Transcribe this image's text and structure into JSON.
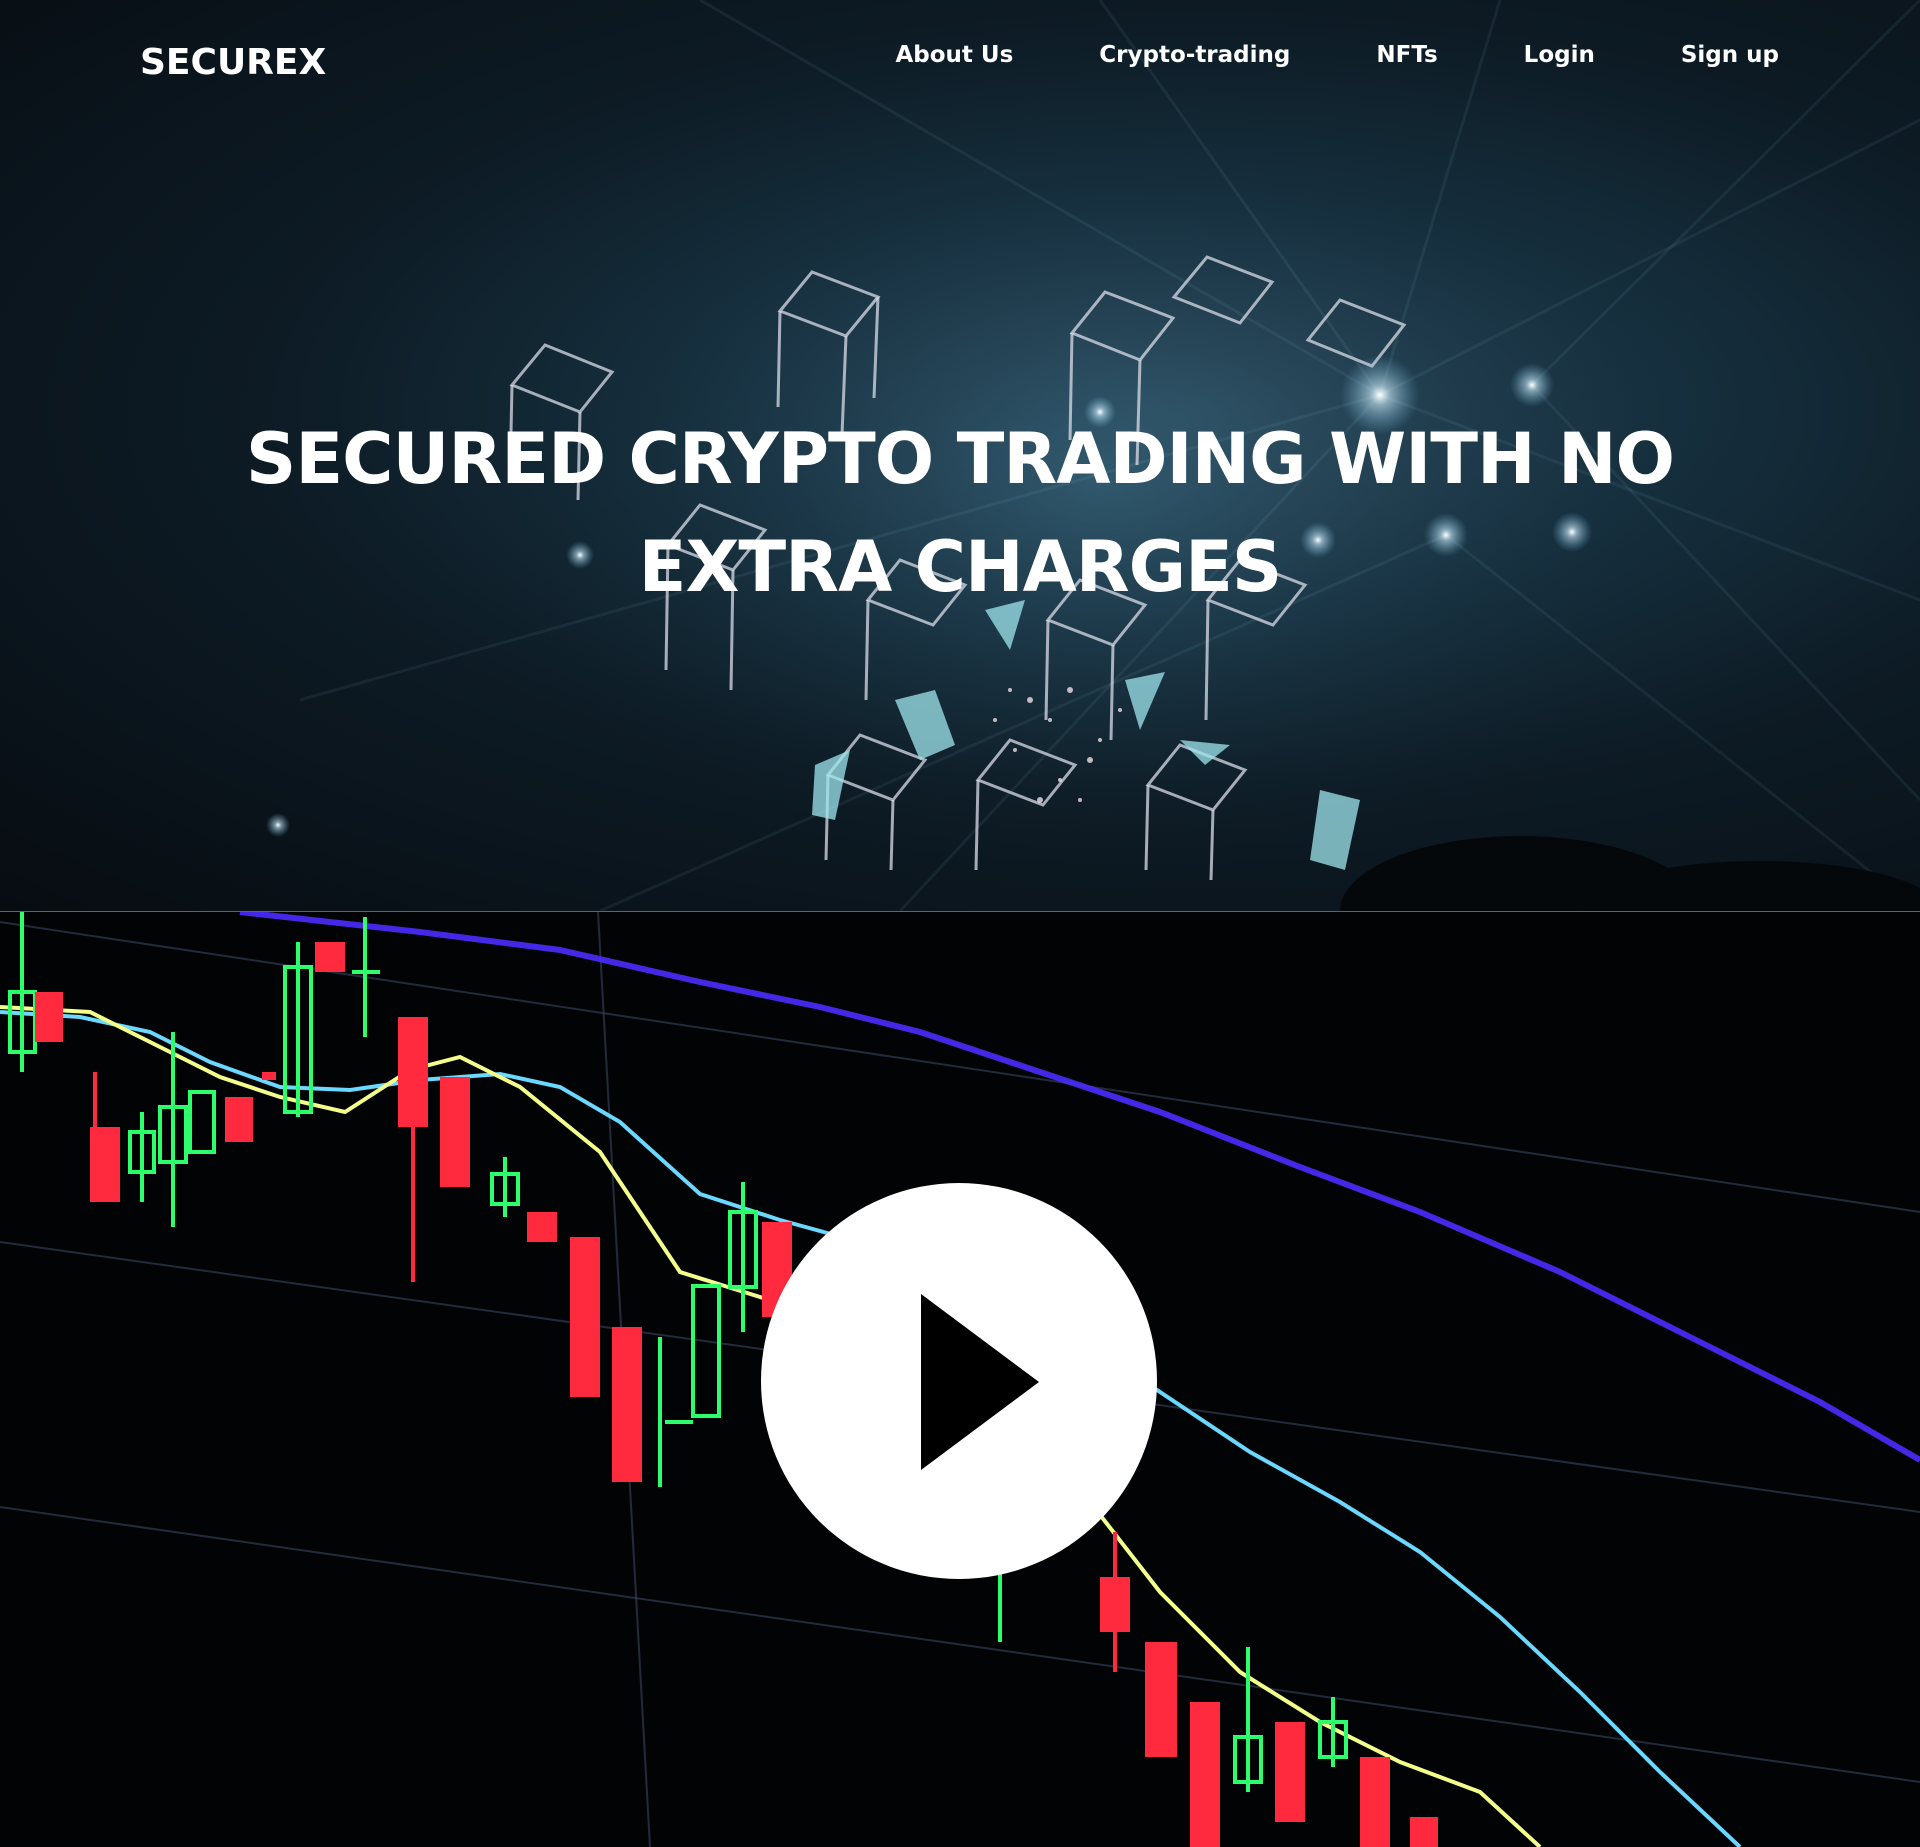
{
  "brand": {
    "name": "SECUREX"
  },
  "nav": {
    "items": [
      {
        "label": "About Us"
      },
      {
        "label": "Crypto-trading"
      },
      {
        "label": "NFTs"
      },
      {
        "label": "Login"
      },
      {
        "label": "Sign up"
      }
    ]
  },
  "hero": {
    "headline": "SECURED CRYPTO TRADING WITH NO EXTRA CHARGES",
    "background_image": "neon-wireframe-cubes-stage"
  },
  "video": {
    "thumbnail_image": "candlestick-trading-chart",
    "play_icon": "play-icon"
  },
  "colors": {
    "text": "#ffffff",
    "hero_dark": "#0d1b25",
    "hero_teal": "#2b4a5c",
    "candle_up": "#2cff6a",
    "candle_down": "#ff2a3d",
    "line_blue": "#4a2cff",
    "line_cyan": "#6ad8ff",
    "line_yellow": "#f4ff8a"
  }
}
